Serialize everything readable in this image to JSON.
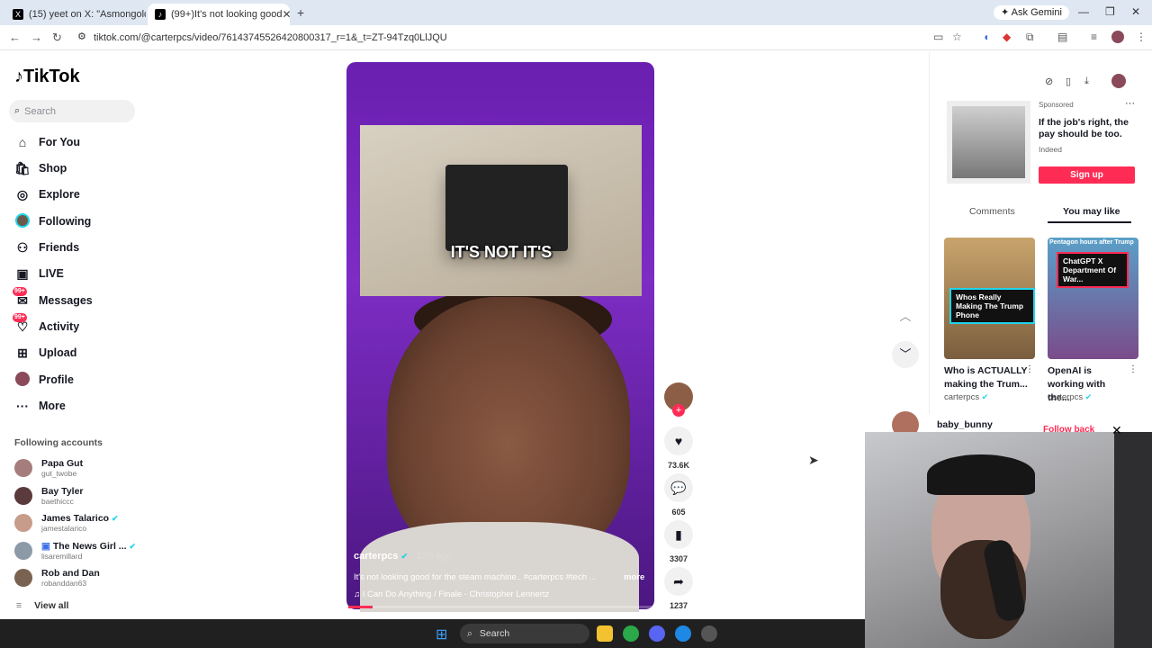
{
  "browser": {
    "tabs": [
      {
        "label": "(15) yeet on X: \"Asmongold sh"
      },
      {
        "label": "(99+)It's not looking good"
      }
    ],
    "url": "tiktok.com/@carterpcs/video/76143745526420800317_r=1&_t=ZT-94Tzq0LlJQU",
    "gemini": "Ask Gemini"
  },
  "tiktok": {
    "logo": "TikTok",
    "search_placeholder": "Search",
    "nav": [
      {
        "label": "For You",
        "icon": "home-icon"
      },
      {
        "label": "Shop",
        "icon": "shop-icon"
      },
      {
        "label": "Explore",
        "icon": "compass-icon"
      },
      {
        "label": "Following",
        "icon": "following-avatar-icon"
      },
      {
        "label": "Friends",
        "icon": "friends-icon"
      },
      {
        "label": "LIVE",
        "icon": "live-icon"
      },
      {
        "label": "Messages",
        "icon": "messages-icon",
        "badge": "99+"
      },
      {
        "label": "Activity",
        "icon": "activity-icon",
        "badge": "99+"
      },
      {
        "label": "Upload",
        "icon": "upload-icon"
      },
      {
        "label": "Profile",
        "icon": "profile-avatar-icon"
      },
      {
        "label": "More",
        "icon": "more-icon"
      }
    ],
    "following_title": "Following accounts",
    "following": [
      {
        "name": "Papa Gut",
        "handle": "gut_twobe"
      },
      {
        "name": "Bay Tyler",
        "handle": "baethiccc"
      },
      {
        "name": "James Talarico",
        "handle": "jamestalarico",
        "verified": true
      },
      {
        "name": "The News Girl ...",
        "handle": "lisaremillard",
        "verified": true
      },
      {
        "name": "Rob and Dan",
        "handle": "robanddan63"
      }
    ],
    "view_all": "View all"
  },
  "video": {
    "caption": "IT'S NOT IT'S",
    "author": "carterpcs",
    "time": "· 13h ago",
    "description": "It's not looking good for the steam machine.. #carterpcs #tech ...",
    "more": "more",
    "music": "♫  I Can Do Anything / Finale - Christopher Lennertz",
    "likes": "73.6K",
    "comments": "605",
    "saves": "3307",
    "shares": "1237",
    "progress": 0.08
  },
  "right": {
    "sponsored": "Sponsored",
    "ad_text": "If the job's right, the pay should be too.",
    "ad_source": "Indeed",
    "signup": "Sign up",
    "tabs": [
      "Comments",
      "You may like"
    ],
    "thumbs": [
      {
        "overlay": "Whos Really Making The Trump Phone",
        "title": "Who is ACTUALLY making the Trum...",
        "author": "carterpcs"
      },
      {
        "overlay": "ChatGPT X Department Of War...",
        "top_text": "Pentagon hours after Trump",
        "title": "OpenAI is working with the...",
        "author": "carterpcs"
      }
    ],
    "notif_user": "baby_bunny",
    "follow_back": "Follow back"
  },
  "taskbar": {
    "search": "Search"
  }
}
